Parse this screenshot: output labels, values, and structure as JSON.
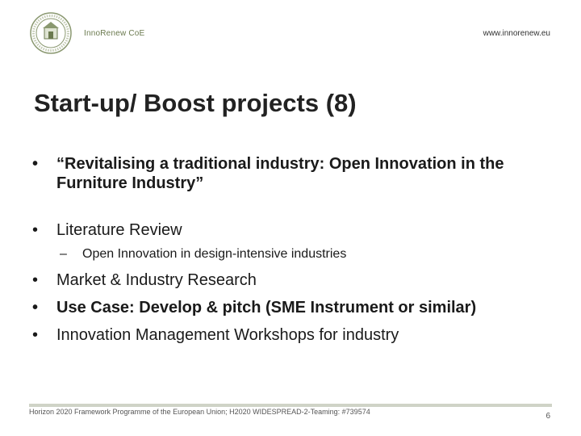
{
  "header": {
    "org": "InnoRenew CoE",
    "url": "www.innorenew.eu",
    "logo_icon": "innorenew-seal-icon",
    "accent_color": "#6b7a4f"
  },
  "title": "Start-up/ Boost projects (8)",
  "bullets": [
    {
      "marker": "•",
      "text": "“Revitalising a traditional industry: Open Innovation in the Furniture Industry”"
    },
    {
      "marker": "•",
      "text": "Literature Review"
    },
    {
      "marker": "–",
      "text": "Open Innovation in design-intensive industries"
    },
    {
      "marker": "•",
      "text": "Market & Industry Research"
    },
    {
      "marker": "•",
      "text": "Use Case: Develop & pitch (SME Instrument or similar)"
    },
    {
      "marker": "•",
      "text": "Innovation Management Workshops for industry"
    }
  ],
  "footer": {
    "funding": "Horizon 2020 Framework Programme of the European Union; H2020 WIDESPREAD-2-Teaming: #739574",
    "page_number": "6"
  }
}
